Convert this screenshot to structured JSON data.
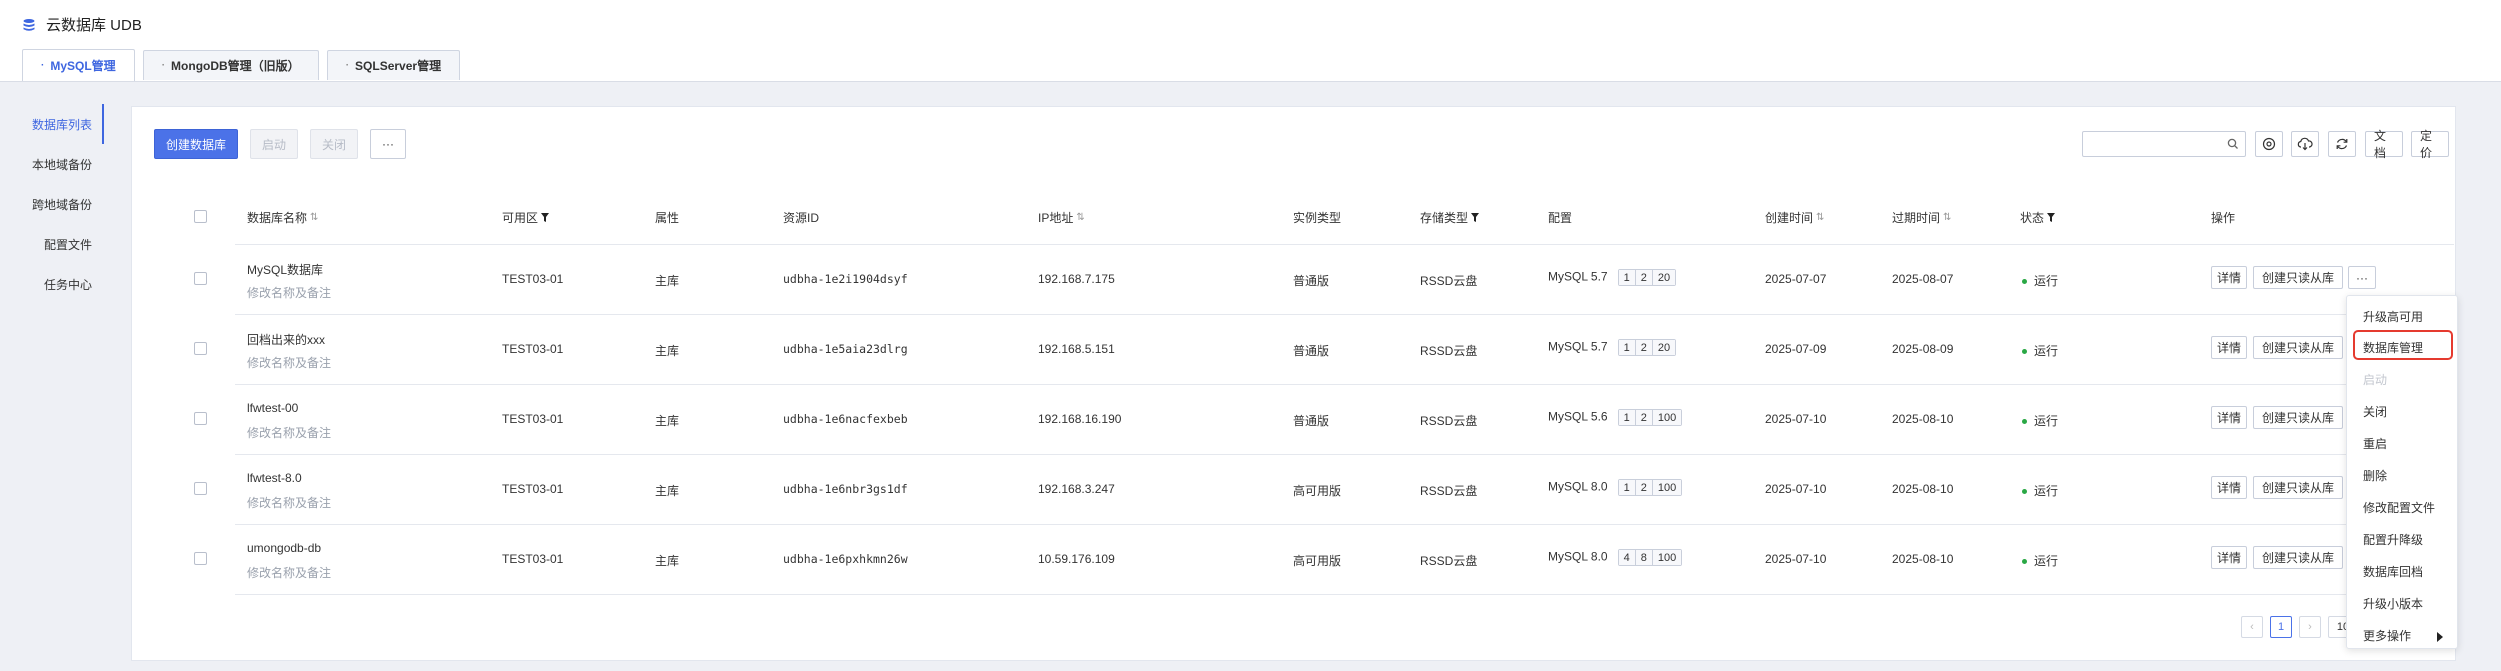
{
  "app": {
    "title": "云数据库 UDB"
  },
  "tabs": [
    {
      "label": "MySQL管理"
    },
    {
      "label": "MongoDB管理（旧版）"
    },
    {
      "label": "SQLServer管理"
    }
  ],
  "sidebar": [
    {
      "label": "数据库列表"
    },
    {
      "label": "本地域备份"
    },
    {
      "label": "跨地域备份"
    },
    {
      "label": "配置文件"
    },
    {
      "label": "任务中心"
    }
  ],
  "toolbar": {
    "create": "创建数据库",
    "start": "启动",
    "close": "关闭",
    "more": "···",
    "search_placeholder": "",
    "docs": "文档",
    "pricing": "定价"
  },
  "table": {
    "headers": {
      "name": "数据库名称",
      "zone": "可用区",
      "attr": "属性",
      "resource_id": "资源ID",
      "ip": "IP地址",
      "instance_type": "实例类型",
      "storage": "存储类型",
      "config": "配置",
      "created": "创建时间",
      "expires": "过期时间",
      "status": "状态",
      "actions": "操作"
    },
    "rows": [
      {
        "name": "MySQL数据库",
        "remark": "修改名称及备注",
        "zone": "TEST03-01",
        "attr": "主库",
        "resource_id": "udbha-1e2i1904dsyf",
        "ip": "192.168.7.175",
        "instance_type": "普通版",
        "storage": "RSSD云盘",
        "version": "MySQL 5.7",
        "spec": [
          "1",
          "2",
          "20"
        ],
        "created": "2025-07-07",
        "expires": "2025-08-07",
        "status": "运行"
      },
      {
        "name": "回档出来的xxx",
        "remark": "修改名称及备注",
        "zone": "TEST03-01",
        "attr": "主库",
        "resource_id": "udbha-1e5aia23dlrg",
        "ip": "192.168.5.151",
        "instance_type": "普通版",
        "storage": "RSSD云盘",
        "version": "MySQL 5.7",
        "spec": [
          "1",
          "2",
          "20"
        ],
        "created": "2025-07-09",
        "expires": "2025-08-09",
        "status": "运行"
      },
      {
        "name": "lfwtest-00",
        "remark": "修改名称及备注",
        "zone": "TEST03-01",
        "attr": "主库",
        "resource_id": "udbha-1e6nacfexbeb",
        "ip": "192.168.16.190",
        "instance_type": "普通版",
        "storage": "RSSD云盘",
        "version": "MySQL 5.6",
        "spec": [
          "1",
          "2",
          "100"
        ],
        "created": "2025-07-10",
        "expires": "2025-08-10",
        "status": "运行"
      },
      {
        "name": "lfwtest-8.0",
        "remark": "修改名称及备注",
        "zone": "TEST03-01",
        "attr": "主库",
        "resource_id": "udbha-1e6nbr3gs1df",
        "ip": "192.168.3.247",
        "instance_type": "高可用版",
        "storage": "RSSD云盘",
        "version": "MySQL 8.0",
        "spec": [
          "1",
          "2",
          "100"
        ],
        "created": "2025-07-10",
        "expires": "2025-08-10",
        "status": "运行"
      },
      {
        "name": "umongodb-db",
        "remark": "修改名称及备注",
        "zone": "TEST03-01",
        "attr": "主库",
        "resource_id": "udbha-1e6pxhkmn26w",
        "ip": "10.59.176.109",
        "instance_type": "高可用版",
        "storage": "RSSD云盘",
        "version": "MySQL 8.0",
        "spec": [
          "4",
          "8",
          "100"
        ],
        "created": "2025-07-10",
        "expires": "2025-08-10",
        "status": "运行"
      }
    ],
    "row_actions": {
      "details": "详情",
      "create_replica": "创建只读从库",
      "more": "···"
    }
  },
  "menu": [
    {
      "label": "升级高可用"
    },
    {
      "label": "数据库管理"
    },
    {
      "label": "启动"
    },
    {
      "label": "关闭"
    },
    {
      "label": "重启"
    },
    {
      "label": "删除"
    },
    {
      "label": "修改配置文件"
    },
    {
      "label": "配置升降级"
    },
    {
      "label": "数据库回档"
    },
    {
      "label": "升级小版本"
    },
    {
      "label": "更多操作"
    }
  ],
  "pagination": {
    "prev": "‹",
    "current": "1",
    "next": "›",
    "size": "10"
  },
  "colors": {
    "accent": "#4b72e8",
    "highlight": "#e53a2f",
    "running": "#2aa845"
  }
}
